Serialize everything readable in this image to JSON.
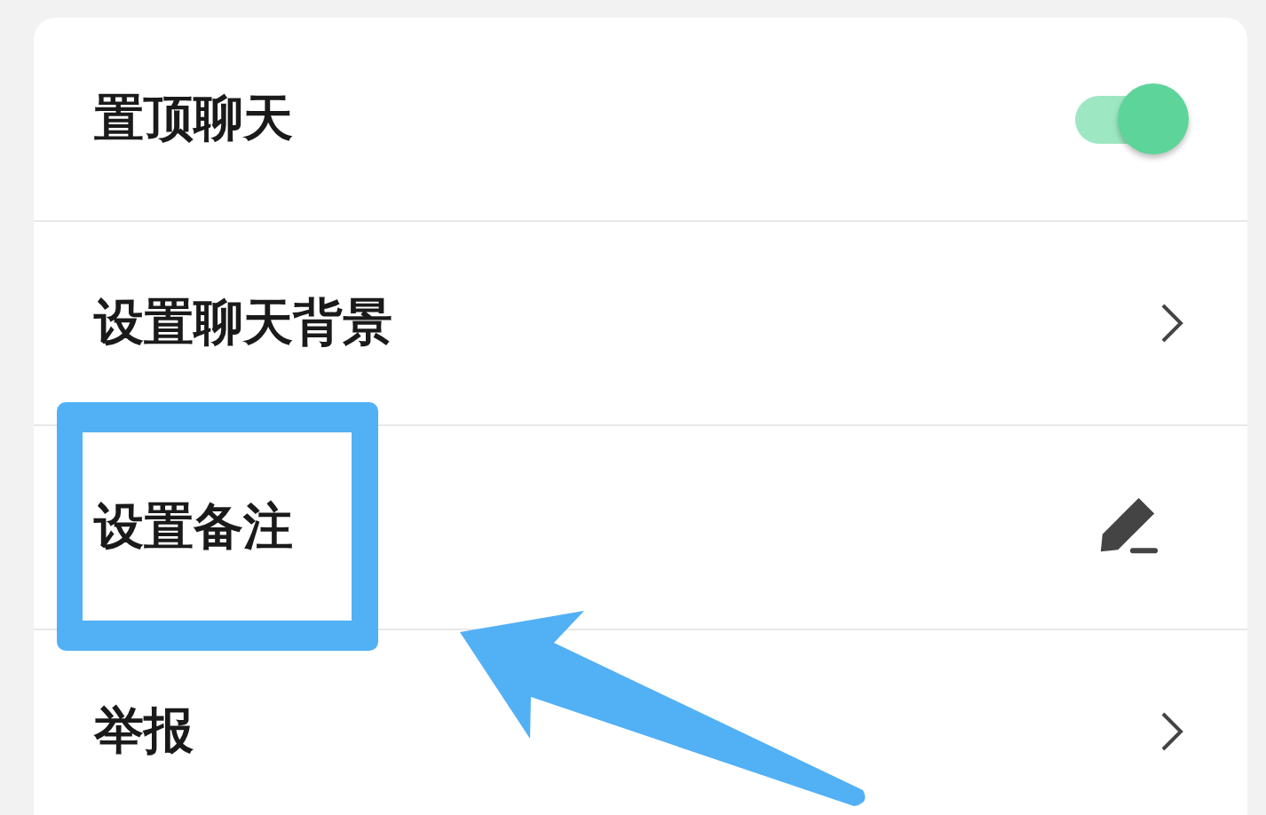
{
  "settings": [
    {
      "label": "置顶聊天",
      "kind": "toggle",
      "on": true
    },
    {
      "label": "设置聊天背景",
      "kind": "chevron"
    },
    {
      "label": "设置备注",
      "kind": "edit"
    },
    {
      "label": "举报",
      "kind": "chevron"
    }
  ]
}
